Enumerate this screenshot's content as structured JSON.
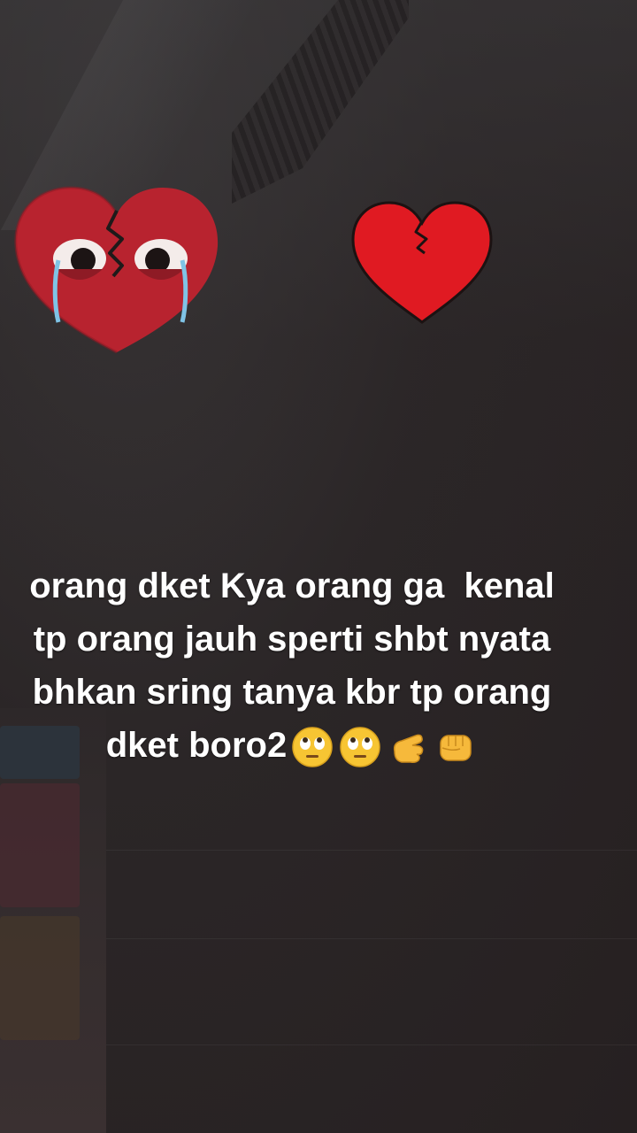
{
  "stickers": {
    "left": {
      "name": "crying-broken-heart",
      "color": "#b8232f"
    },
    "right": {
      "name": "broken-heart",
      "color": "#e01a22"
    }
  },
  "caption": {
    "lines": [
      "orang dket Kya orang ga  kenal",
      "tp orang jauh sperti shbt nyata",
      "bhkan sring tanya kbr tp orang",
      "dket boro2"
    ],
    "emojis": [
      "face-with-rolling-eyes",
      "face-with-rolling-eyes",
      "backhand-pointing-hand",
      "oncoming-fist"
    ]
  }
}
